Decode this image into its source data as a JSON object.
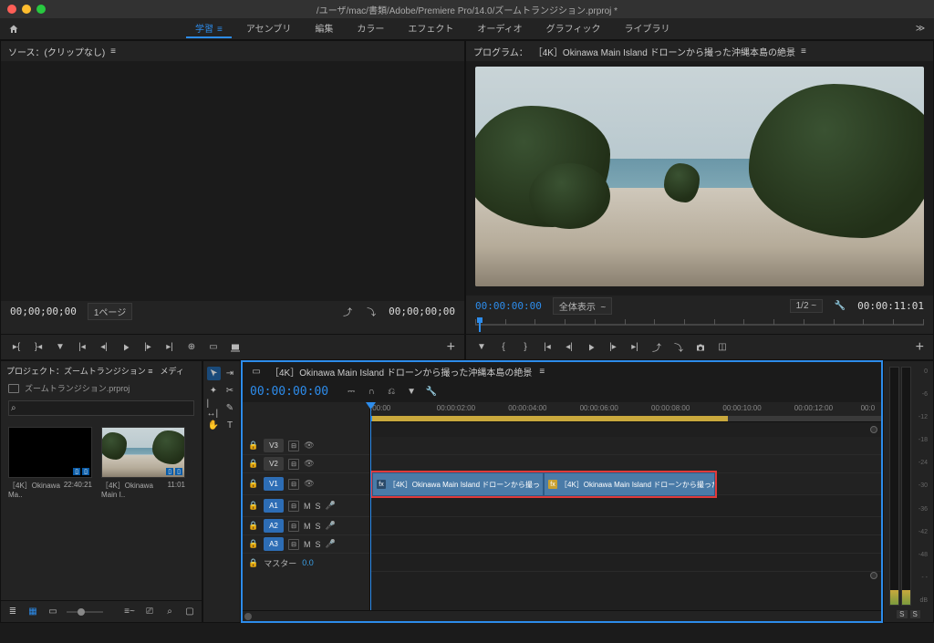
{
  "title": "/ユーザ/mac/書類/Adobe/Premiere Pro/14.0/ズームトランジション.prproj *",
  "workspaces": [
    "学習",
    "アセンブリ",
    "編集",
    "カラー",
    "エフェクト",
    "オーディオ",
    "グラフィック",
    "ライブラリ"
  ],
  "active_workspace": 0,
  "source": {
    "tab": "ソース：(クリップなし)",
    "tc": "00;00;00;00",
    "page": "1ページ"
  },
  "program": {
    "tab_prefix": "プログラム：",
    "clip_name": "［4K］Okinawa Main Island ドローンから撮った沖縄本島の絶景",
    "tc_in": "00:00:00:00",
    "fit": "全体表示",
    "zoom": "1/2",
    "tc_out": "00:00:11:01"
  },
  "project": {
    "tab": "プロジェクト：ズームトランジション",
    "tab2": "メディ",
    "file": "ズームトランジション.prproj",
    "search_placeholder": "",
    "bins": [
      {
        "name": "［4K］Okinawa Ma..",
        "dur": "22:40:21"
      },
      {
        "name": "［4K］Okinawa Main I..",
        "dur": "11:01"
      }
    ]
  },
  "timeline": {
    "sequence": "［4K］Okinawa Main Island ドローンから撮った沖縄本島の絶景",
    "tc": "00:00:00:00",
    "ruler": [
      ":00:00",
      "00:00:02:00",
      "00:00:04:00",
      "00:00:06:00",
      "00:00:08:00",
      "00:00:10:00",
      "00:00:12:00",
      "00:0"
    ],
    "tracks_v": [
      "V3",
      "V2",
      "V1"
    ],
    "tracks_a": [
      "A1",
      "A2",
      "A3"
    ],
    "master": "マスター",
    "master_val": "0.0",
    "clip1": "［4K］Okinawa Main Island ドローンから撮っ",
    "clip2": "［4K］Okinawa Main Island ドローンから撮った"
  },
  "meters": {
    "scale": [
      "0",
      "-6",
      "-12",
      "-18",
      "-24",
      "-30",
      "-36",
      "-42",
      "-48",
      "- -",
      "dB"
    ],
    "foot": [
      "S",
      "S"
    ]
  }
}
